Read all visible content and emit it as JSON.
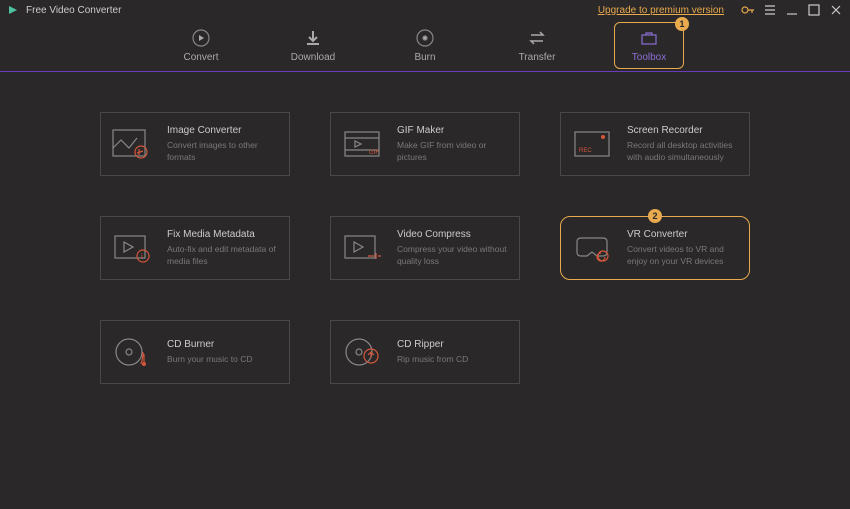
{
  "titlebar": {
    "app_name": "Free Video Converter",
    "premium_link": "Upgrade to premium version"
  },
  "nav": {
    "items": [
      {
        "label": "Convert"
      },
      {
        "label": "Download"
      },
      {
        "label": "Burn"
      },
      {
        "label": "Transfer"
      },
      {
        "label": "Toolbox"
      }
    ]
  },
  "badges": {
    "nav": "1",
    "vr": "2"
  },
  "tools": [
    {
      "title": "Image Converter",
      "desc": "Convert images to other formats"
    },
    {
      "title": "GIF Maker",
      "desc": "Make GIF from video or pictures"
    },
    {
      "title": "Screen Recorder",
      "desc": "Record all desktop activities with audio simultaneously"
    },
    {
      "title": "Fix Media Metadata",
      "desc": "Auto-fix and edit metadata of media files"
    },
    {
      "title": "Video Compress",
      "desc": "Compress your video without quality loss"
    },
    {
      "title": "VR Converter",
      "desc": "Convert videos to VR and enjoy on your VR devices"
    },
    {
      "title": "CD Burner",
      "desc": "Burn your music to CD"
    },
    {
      "title": "CD Ripper",
      "desc": "Rip music from CD"
    }
  ]
}
